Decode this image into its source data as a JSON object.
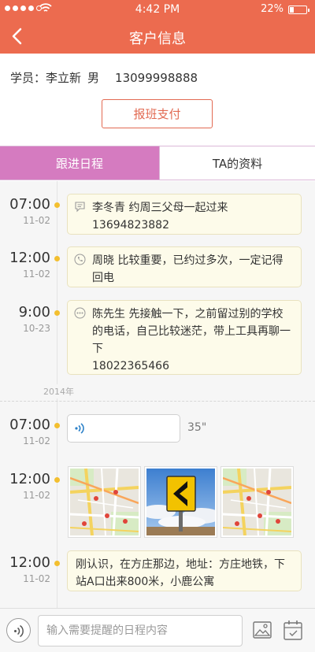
{
  "status_bar": {
    "time": "4:42 PM",
    "battery_text": "22%",
    "battery_level": 0.22
  },
  "nav": {
    "title": "客户信息"
  },
  "student": {
    "label": "学员：",
    "name": "李立新",
    "gender": "男",
    "phone": "13099998888"
  },
  "pay_button": "报班支付",
  "tabs": [
    {
      "label": "跟进日程",
      "active": true
    },
    {
      "label": "TA的资料",
      "active": false
    }
  ],
  "entries": [
    {
      "time": "07:00",
      "date": "11-02",
      "icon": "chat-bubble-icon",
      "text": "李冬青  约周三父母一起过来\n13694823882"
    },
    {
      "time": "12:00",
      "date": "11-02",
      "icon": "phone-icon",
      "text": "周晓  比较重要，已约过多次，一定记得回电"
    },
    {
      "time": "9:00",
      "date": "10-23",
      "icon": "more-dots-icon",
      "text": "陈先生  先接触一下，之前留过别的学校的电话，自己比较迷茫，带上工具再聊一下\n18022365466"
    }
  ],
  "year_label": "2014年",
  "media_entries": [
    {
      "time": "07:00",
      "date": "11-02",
      "voice_duration": "35\""
    },
    {
      "time": "12:00",
      "date": "11-02",
      "images": [
        "map-thumbnail",
        "road-sign-photo",
        "map-thumbnail"
      ]
    },
    {
      "time": "12:00",
      "date": "11-02",
      "text": "刚认识，在方庄那边，地址：方庄地铁，下站A口出来800米，小鹿公寓"
    }
  ],
  "input": {
    "placeholder": "输入需要提醒的日程内容"
  },
  "colors": {
    "brand": "#ec6b4f",
    "tab_active": "#d57bc0",
    "dot": "#f3bf2f",
    "bubble_bg": "#fdfbea"
  }
}
